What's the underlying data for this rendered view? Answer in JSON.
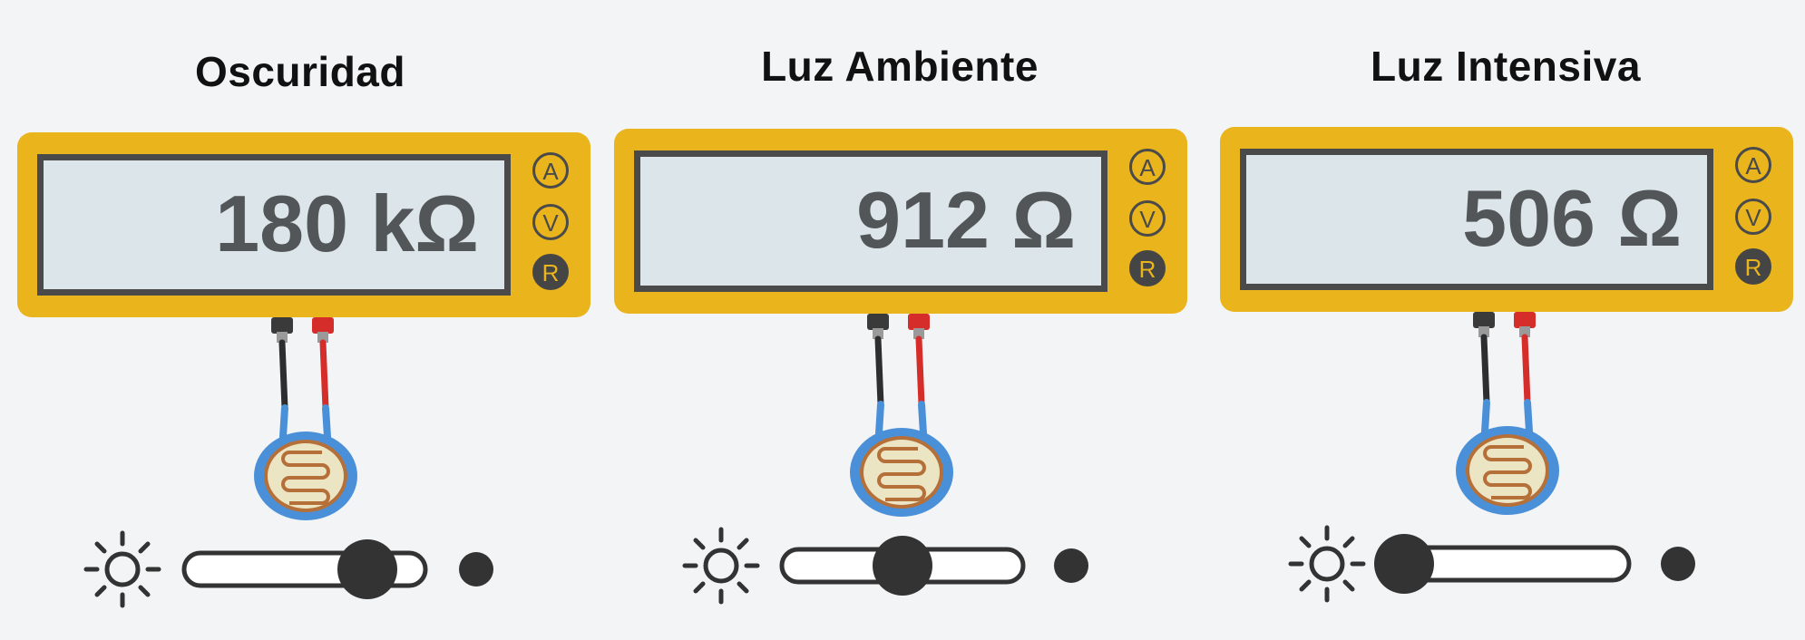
{
  "colors": {
    "meter_body": "#e9b41c",
    "display_bg": "#dce5ea",
    "frame": "#4a4a4a",
    "probe_red": "#d52d2a",
    "probe_black": "#3a3a3a",
    "sensor_border": "#4a90d9",
    "sensor_fill": "#ece5c4",
    "sensor_trace": "#b5703a",
    "control_dark": "#333333"
  },
  "panels": [
    {
      "title": "Oscuridad",
      "reading": "180 kΩ",
      "modes": {
        "a": "A",
        "v": "V",
        "r": "R"
      },
      "active_mode": "R",
      "light_slider_level": 0.8,
      "slider_arrow": "←"
    },
    {
      "title": "Luz Ambiente",
      "reading": "912 Ω",
      "modes": {
        "a": "A",
        "v": "V",
        "r": "R"
      },
      "active_mode": "R",
      "light_slider_level": 0.5
    },
    {
      "title": "Luz Intensiva",
      "reading": "506 Ω",
      "modes": {
        "a": "A",
        "v": "V",
        "r": "R"
      },
      "active_mode": "R",
      "light_slider_level": 0.0
    }
  ]
}
